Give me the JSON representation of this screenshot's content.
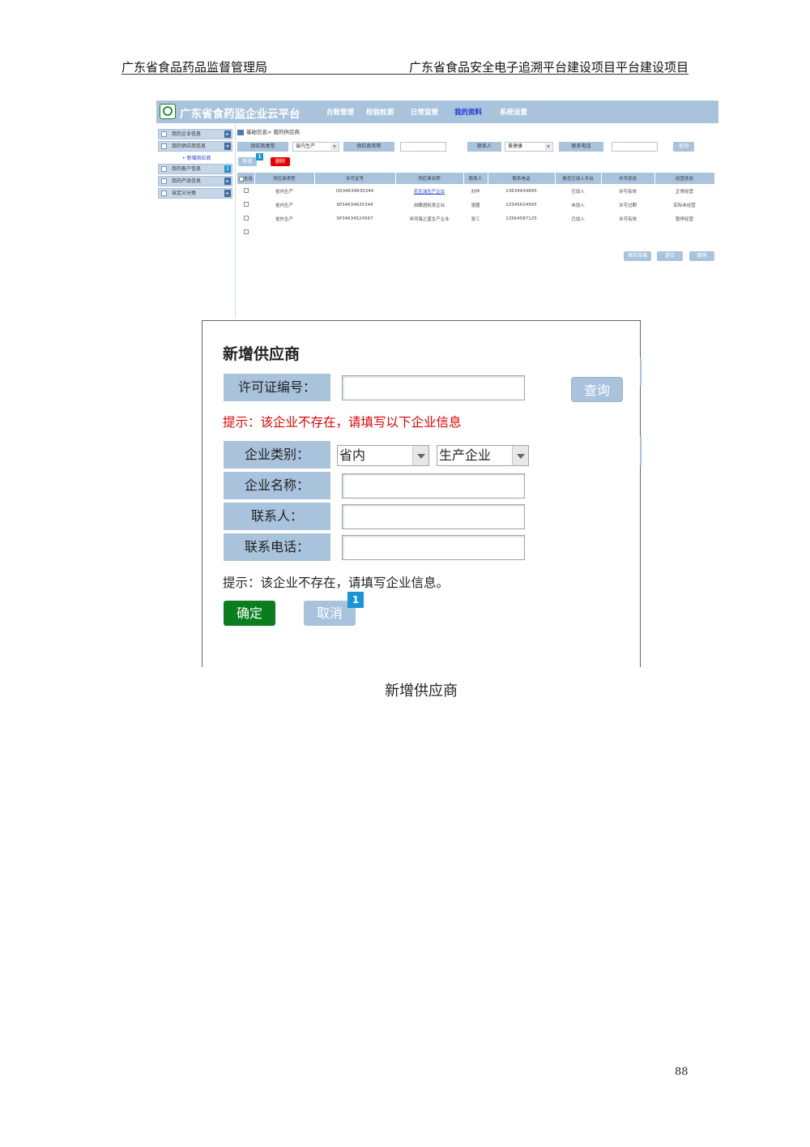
{
  "header": {
    "left": "广东省食品药品监督管理局",
    "right": "广东省食品安全电子追溯平台建设项目平台建设项目"
  },
  "app": {
    "brand": "广东省食药监企业云平台",
    "nav": [
      "台账管理",
      "检验检测",
      "日常监管",
      "我的资料",
      "系统设置"
    ],
    "nav_active": "我的资料",
    "menu": [
      "我的企业信息",
      "我的供应商信息",
      "我的客户信息",
      "我的产品信息",
      "自定义分类"
    ],
    "menu_sub": "• 新增供应商",
    "menu_badge": "2",
    "breadcrumb": "基础信息> 我的供应商",
    "filter": {
      "type_label": "供应商类型",
      "type_value": "省内生产",
      "name_label": "供应商名称",
      "contact_label": "联系人",
      "contact_value": "黄建康",
      "phone_label": "联系电话",
      "query": "查询"
    },
    "add_button": "新增",
    "add_badge": "1",
    "delete_button": "删除",
    "table": {
      "headers": [
        "全选",
        "供应商类型",
        "许可证号",
        "供应商名称",
        "联系人",
        "联系电话",
        "是否已加入平台",
        "许可状态",
        "经营状态"
      ],
      "rows": [
        [
          "",
          "省内生产",
          "QS34634635344",
          "花生油生产企业",
          "刘华",
          "13634934845",
          "已加入",
          "许可有效",
          "正常经营"
        ],
        [
          "",
          "省内生产",
          "SP34634635344",
          "自酿酒批发企业",
          "张圆",
          "13345634565",
          "未加入",
          "许可过期",
          "实际未经营"
        ],
        [
          "",
          "省外生产",
          "SP34634524567",
          "洋河海之蓝生产企业",
          "张三",
          "13564587125",
          "已加入",
          "许可有效",
          "暂停经营"
        ],
        [
          "",
          "",
          "",
          "",
          "",
          "",
          "",
          "",
          ""
        ]
      ]
    },
    "bottom_buttons": [
      "保存草稿",
      "提交",
      "撤销"
    ]
  },
  "dialog": {
    "title": "新增供应商",
    "license_label": "许可证编号：",
    "query_button": "查询",
    "warning_red": "提示：该企业不存在，请填写以下企业信息",
    "type_label": "企业类别：",
    "type_region": "省内",
    "type_kind": "生产企业",
    "name_label": "企业名称：",
    "contact_label": "联系人：",
    "phone_label": "联系电话：",
    "warning_black": "提示：该企业不存在，请填写企业信息。",
    "ok_button": "确定",
    "cancel_button": "取消",
    "cancel_badge": "1"
  },
  "caption": "新增供应商",
  "page_number": "88",
  "colors": {
    "accent": "#a9c3dd",
    "ok": "#0a7d1e",
    "warn": "#e60000",
    "badge": "#1995d6"
  }
}
